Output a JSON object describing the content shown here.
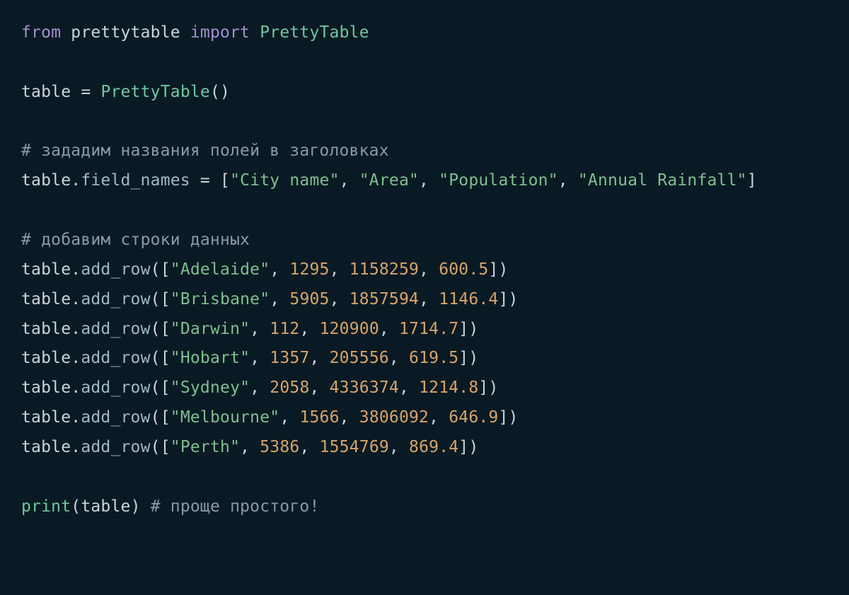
{
  "code": {
    "line1": {
      "kw_from": "from",
      "module": "prettytable",
      "kw_import": "import",
      "classname": "PrettyTable"
    },
    "line2_blank": "",
    "line3": {
      "var": "table",
      "eq": "=",
      "classname": "PrettyTable",
      "parens": "()"
    },
    "line4_blank": "",
    "comment1": "# зададим названия полей в заголовках",
    "line6": {
      "obj": "table",
      "dot": ".",
      "attr": "field_names",
      "eq": "=",
      "lb": "[",
      "s1": "\"City name\"",
      "c": ",",
      "s2": "\"Area\"",
      "s3": "\"Population\"",
      "s4": "\"Annual Rainfall\"",
      "rb": "]"
    },
    "line7_blank": "",
    "comment2": "# добавим строки данных",
    "rows": [
      {
        "city": "\"Adelaide\"",
        "n1": "1295",
        "n2": "1158259",
        "n3": "600.5"
      },
      {
        "city": "\"Brisbane\"",
        "n1": "5905",
        "n2": "1857594",
        "n3": "1146.4"
      },
      {
        "city": "\"Darwin\"",
        "n1": "112",
        "n2": "120900",
        "n3": "1714.7"
      },
      {
        "city": "\"Hobart\"",
        "n1": "1357",
        "n2": "205556",
        "n3": "619.5"
      },
      {
        "city": "\"Sydney\"",
        "n1": "2058",
        "n2": "4336374",
        "n3": "1214.8"
      },
      {
        "city": "\"Melbourne\"",
        "n1": "1566",
        "n2": "3806092",
        "n3": "646.9"
      },
      {
        "city": "\"Perth\"",
        "n1": "5386",
        "n2": "1554769",
        "n3": "869.4"
      }
    ],
    "row_tpl": {
      "obj": "table",
      "dot": ".",
      "method": "add_row",
      "lp": "(",
      "lb": "[",
      "c": ",",
      "rb": "]",
      "rp": ")"
    },
    "line_last": {
      "fn": "print",
      "lp": "(",
      "arg": "table",
      "rp": ")",
      "comment": "# проще простого!"
    }
  }
}
